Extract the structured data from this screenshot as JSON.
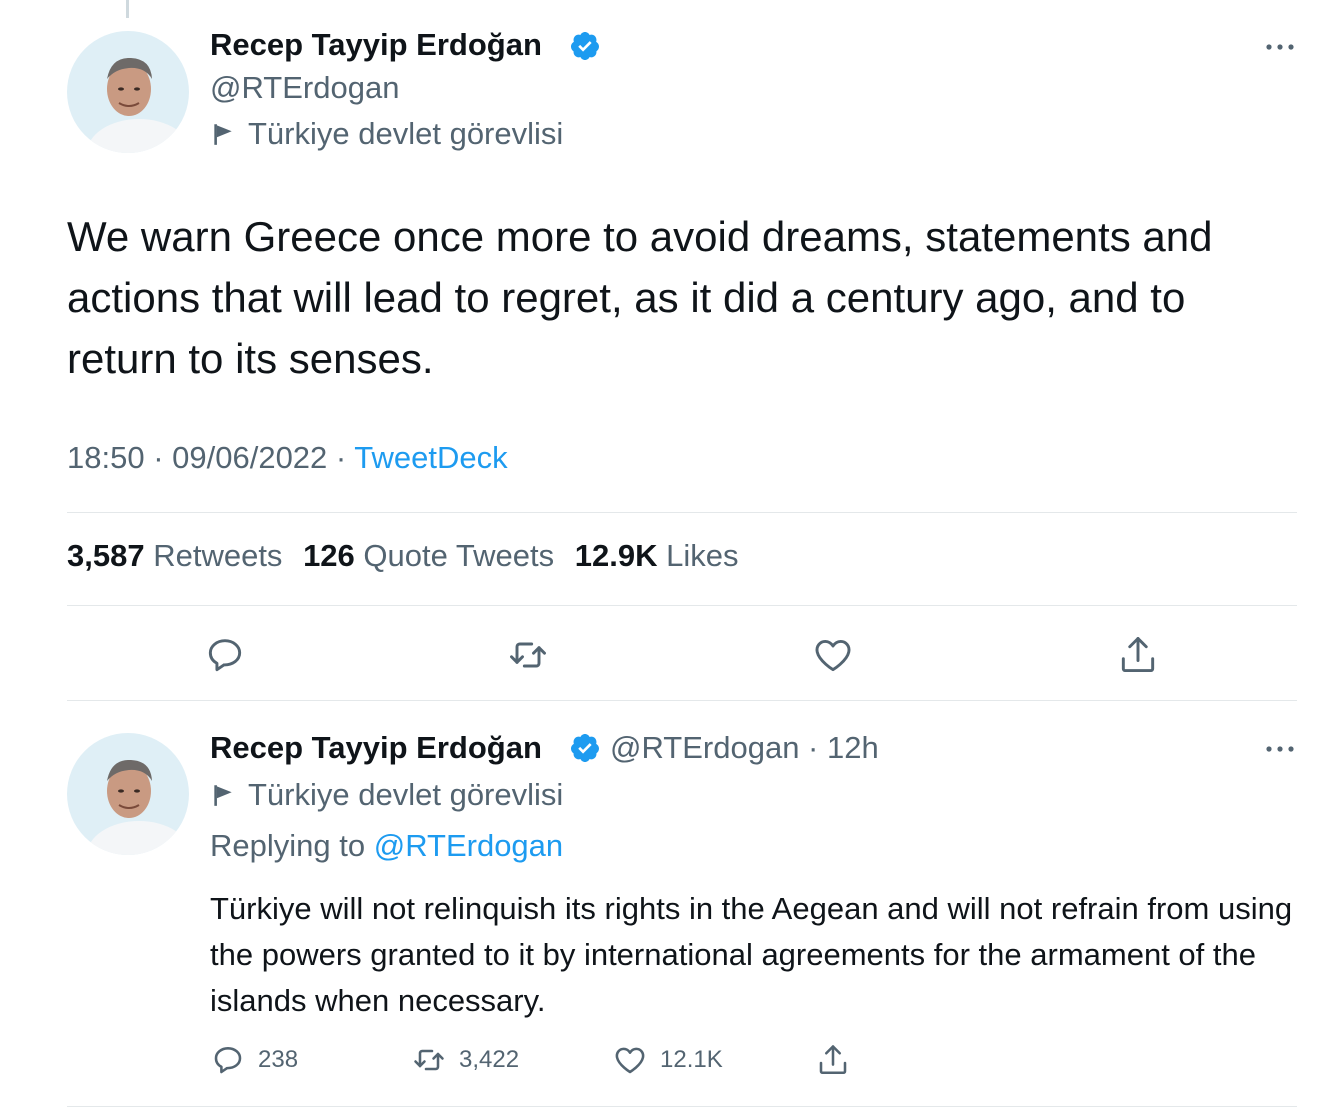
{
  "main_tweet": {
    "author_name": "Recep Tayyip Erdoğan",
    "handle": "@RTErdogan",
    "label": "Türkiye devlet görevlisi",
    "text": "We warn Greece once more to avoid dreams, statements and actions that will lead to regret, as it did a century ago, and to return to its senses.",
    "time": "18:50",
    "date": "09/06/2022",
    "source": "TweetDeck",
    "stats": {
      "retweets_count": "3,587",
      "retweets_label": "Retweets",
      "quotes_count": "126",
      "quotes_label": "Quote Tweets",
      "likes_count": "12.9K",
      "likes_label": "Likes"
    },
    "actions": [
      "reply-icon",
      "retweet-icon",
      "like-icon",
      "share-icon"
    ]
  },
  "reply_tweet": {
    "author_name": "Recep Tayyip Erdoğan",
    "handle": "@RTErdogan",
    "time_ago": "12h",
    "label": "Türkiye devlet görevlisi",
    "replying_to_prefix": "Replying to",
    "replying_to_handle": "@RTErdogan",
    "text": "Türkiye will not relinquish its rights in the Aegean and will not refrain from using the powers granted to it by international agreements for the armament of the islands when necessary.",
    "counts": {
      "replies": "238",
      "retweets": "3,422",
      "likes": "12.1K"
    }
  },
  "colors": {
    "accent": "#1d9bf0",
    "muted": "#536471",
    "text": "#0f1419",
    "divider": "#e4e8ea"
  }
}
